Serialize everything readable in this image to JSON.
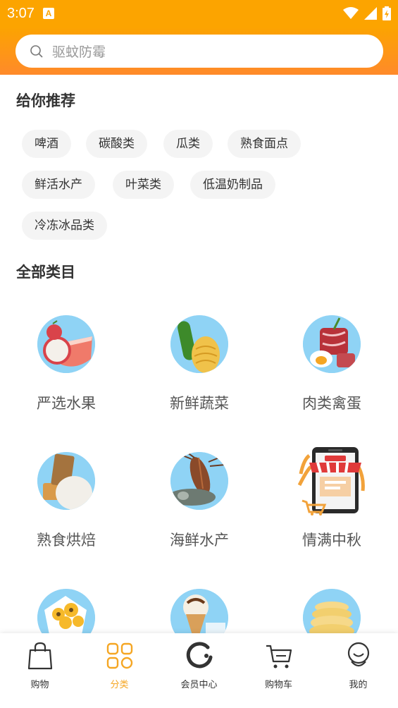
{
  "status": {
    "time": "3:07",
    "a_glyph": "A"
  },
  "search": {
    "placeholder": "驱蚊防霉"
  },
  "recommend": {
    "title": "给你推荐",
    "tags": [
      "啤酒",
      "碳酸类",
      "瓜类",
      "熟食面点",
      "鲜活水产",
      "叶菜类",
      "低温奶制品",
      "冷冻冰品类"
    ]
  },
  "categories": {
    "title": "全部类目",
    "items": [
      {
        "label": "严选水果",
        "icon": "fruit-icon"
      },
      {
        "label": "新鲜蔬菜",
        "icon": "vegetable-icon"
      },
      {
        "label": "肉类禽蛋",
        "icon": "meat-egg-icon"
      },
      {
        "label": "熟食烘焙",
        "icon": "bakery-icon"
      },
      {
        "label": "海鲜水产",
        "icon": "seafood-icon"
      },
      {
        "label": "情满中秋",
        "icon": "shop-sale-icon"
      },
      {
        "label": "",
        "icon": "flowers-icon"
      },
      {
        "label": "",
        "icon": "ice-cream-icon"
      },
      {
        "label": "",
        "icon": "chips-icon"
      }
    ]
  },
  "tabbar": {
    "active": "分类",
    "active_color": "#f5a623",
    "items": [
      {
        "label": "购物",
        "icon": "shopping-bag-icon"
      },
      {
        "label": "分类",
        "icon": "category-grid-icon"
      },
      {
        "label": "会员中心",
        "icon": "member-icon"
      },
      {
        "label": "购物车",
        "icon": "cart-icon"
      },
      {
        "label": "我的",
        "icon": "profile-icon"
      }
    ]
  },
  "colors": {
    "brand": "#fca400",
    "tag_bg": "#f4f4f4"
  }
}
